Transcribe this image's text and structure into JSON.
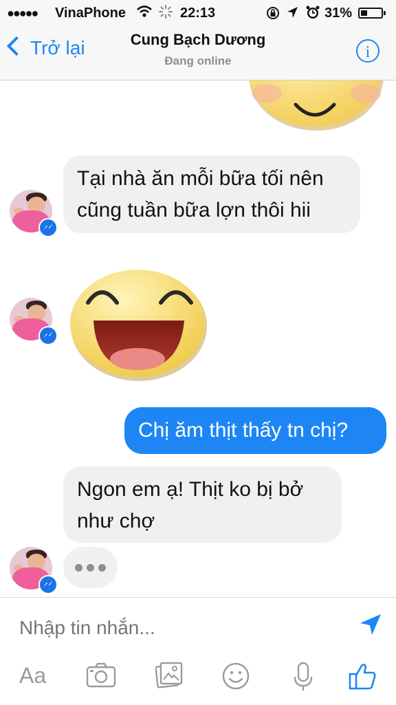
{
  "status_bar": {
    "signal": "●●●●●",
    "carrier": "VinaPhone",
    "time": "22:13",
    "battery_percent": "31%",
    "battery_level": 0.31
  },
  "nav": {
    "back_label": "Trở lại",
    "contact_name": "Cung Bạch Dương",
    "presence": "Đang online",
    "info_label": "i"
  },
  "messages": [
    {
      "sender": "contact",
      "type": "text",
      "lines": [
        "Tại nhà ăn mỗi bữa tối nên",
        "cũng tuần bữa lợn thôi hii"
      ]
    },
    {
      "sender": "contact",
      "type": "sticker",
      "sticker": "laughing-smiley"
    },
    {
      "sender": "me",
      "type": "text",
      "lines": [
        "Chị ăm thịt thấy tn chị?"
      ]
    },
    {
      "sender": "contact",
      "type": "text",
      "lines": [
        "Ngon em ạ! Thịt ko bị bở",
        "như chợ"
      ]
    },
    {
      "sender": "contact",
      "type": "typing-indicator",
      "dots": "•••"
    }
  ],
  "composer": {
    "placeholder": "Nhập tin nhắn...",
    "text_format_label": "Aa",
    "icons": [
      "send-icon",
      "camera-icon",
      "gallery-icon",
      "emoji-icon",
      "microphone-icon",
      "like-icon"
    ]
  },
  "colors": {
    "accent": "#1d86f4",
    "incoming_bubble": "#f1f0f0",
    "header_bg": "#f7f7f7",
    "muted_icon": "#9a9a9f"
  }
}
